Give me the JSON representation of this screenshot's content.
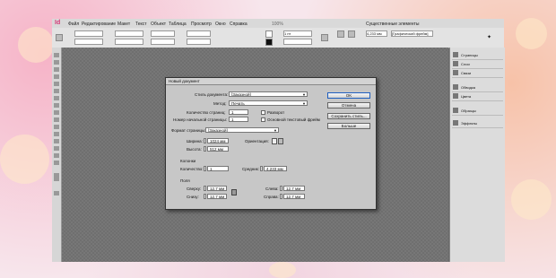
{
  "app": {
    "logo": "Id",
    "menu": [
      "Файл",
      "Редактирование",
      "Макет",
      "Текст",
      "Объект",
      "Таблица",
      "Просмотр",
      "Окно",
      "Справка"
    ],
    "workspace_label": "Существенные элементы",
    "zoom": "100%",
    "control": {
      "stroke": "1 пт",
      "size": "4,233 мм",
      "frame": "[Графический фрейм]"
    }
  },
  "panel": {
    "items": [
      "Страницы",
      "Слои",
      "Связи",
      "Обводка",
      "Цвета",
      "Образцы",
      "Эффекты"
    ]
  },
  "dialog": {
    "title": "Новый документ",
    "preset_label": "Стиль документа:",
    "preset_value": "[Заказной]",
    "intent_label": "Метод:",
    "intent_value": "Печать",
    "pages_label": "Количество страниц:",
    "pages_value": "1",
    "start_label": "Номер начальной страницы:",
    "start_value": "1",
    "facing_label": "Разворот",
    "master_label": "Основной текстовый фрейм",
    "size_label": "Формат страницы:",
    "size_value": "[Заказной]",
    "width_label": "Ширина:",
    "width_value": "1024 мм",
    "height_label": "Высота:",
    "height_value": "512 мм",
    "orientation_label": "Ориентация:",
    "columns_title": "Колонки",
    "col_count_label": "Количество:",
    "col_count_value": "1",
    "gutter_label": "Средник:",
    "gutter_value": "4,233 мм",
    "margins_title": "Поля",
    "top_label": "Сверху:",
    "top_value": "12,7 мм",
    "bottom_label": "Снизу:",
    "bottom_value": "12,7 мм",
    "left_label": "Слева:",
    "left_value": "12,7 мм",
    "right_label": "Справа:",
    "right_value": "12,7 мм",
    "buttons": {
      "ok": "OK",
      "cancel": "Отмена",
      "save": "Сохранить стиль...",
      "more": "Больше"
    }
  }
}
